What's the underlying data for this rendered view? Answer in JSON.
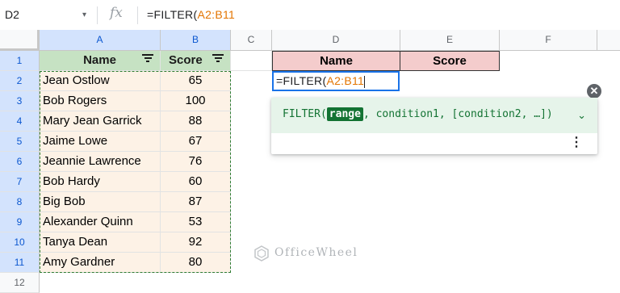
{
  "formula_bar": {
    "name_box": "D2",
    "dropdown_icon": "▾",
    "fx_label": "fx",
    "formula_prefix": "=FILTER(",
    "formula_ref": "A2:B11"
  },
  "columns": [
    "A",
    "B",
    "C",
    "D",
    "E",
    "F"
  ],
  "rows": [
    "1",
    "2",
    "3",
    "4",
    "5",
    "6",
    "7",
    "8",
    "9",
    "10",
    "11",
    "12"
  ],
  "table": {
    "headers": [
      "Name",
      "Score"
    ],
    "records": [
      {
        "name": "Jean Ostlow",
        "score": "65"
      },
      {
        "name": "Bob Rogers",
        "score": "100"
      },
      {
        "name": "Mary Jean Garrick",
        "score": "88"
      },
      {
        "name": "Jaime Lowe",
        "score": "67"
      },
      {
        "name": "Jeannie Lawrence",
        "score": "76"
      },
      {
        "name": "Bob Hardy",
        "score": "60"
      },
      {
        "name": "Big Bob",
        "score": "87"
      },
      {
        "name": "Alexander Quinn",
        "score": "53"
      },
      {
        "name": "Tanya Dean",
        "score": "92"
      },
      {
        "name": "Amy Gardner",
        "score": "80"
      }
    ]
  },
  "output": {
    "headers": [
      "Name",
      "Score"
    ],
    "editor_prefix": "=FILTER(",
    "editor_ref": "A2:B11"
  },
  "tooltip": {
    "func_name": "FILTER(",
    "arg_highlight": "range",
    "rest_args": ", condition1, [condition2, …])",
    "chevron": "⌄",
    "menu_icon": "⋮",
    "close_icon": "✕"
  },
  "watermark": {
    "text": "OfficeWheel"
  },
  "colors": {
    "header_green": "#c6e2c3",
    "data_peach": "#fdf2e6",
    "output_header_pink": "#f4cccc",
    "selection_blue": "#1a73e8",
    "tooltip_green": "#137333"
  }
}
